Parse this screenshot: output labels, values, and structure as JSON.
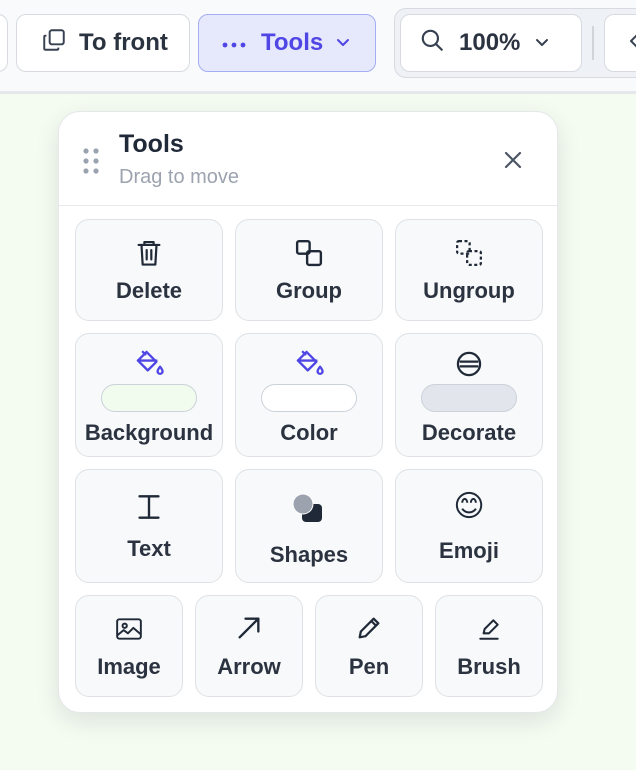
{
  "toolbar": {
    "to_front_label": "To front",
    "tools_label": "Tools",
    "zoom_label": "100%"
  },
  "panel": {
    "title": "Tools",
    "subtitle": "Drag to move",
    "tools": {
      "delete": "Delete",
      "group": "Group",
      "ungroup": "Ungroup",
      "background": "Background",
      "color": "Color",
      "decorate": "Decorate",
      "text": "Text",
      "shapes": "Shapes",
      "emoji": "Emoji",
      "emoji_glyph": "😊",
      "image": "Image",
      "arrow": "Arrow",
      "pen": "Pen",
      "brush": "Brush"
    },
    "swatches": {
      "background": "#f1fbee",
      "color": "#ffffff",
      "decorate": "#e2e6ec"
    }
  },
  "colors": {
    "accent": "#4f46e5",
    "accent_bg": "#e6e8fb",
    "canvas_bg": "#f4fbf1"
  }
}
